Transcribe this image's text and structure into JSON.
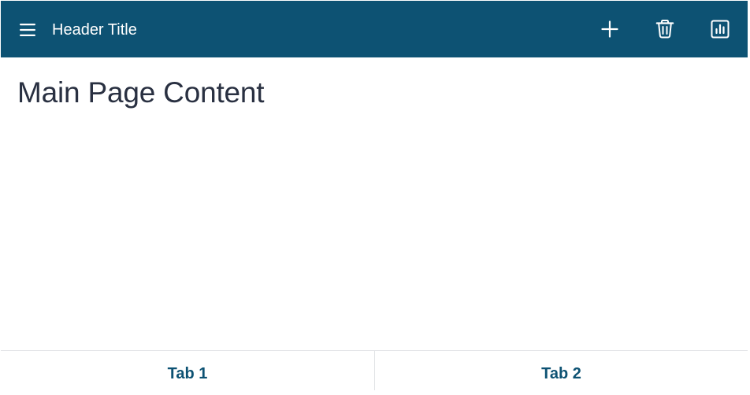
{
  "colors": {
    "header_bg": "#0d5273",
    "header_text": "#ffffff",
    "page_title": "#293041",
    "tab_text": "#0d5273",
    "divider": "#e3e5e8"
  },
  "header": {
    "menu_icon": "hamburger-menu-icon",
    "title": "Header Title",
    "actions": [
      {
        "icon": "plus-icon",
        "name": "add-button"
      },
      {
        "icon": "trash-icon",
        "name": "delete-button"
      },
      {
        "icon": "bar-chart-icon",
        "name": "chart-button"
      }
    ]
  },
  "main": {
    "title": "Main Page Content"
  },
  "tabs": [
    {
      "label": "Tab 1"
    },
    {
      "label": "Tab 2"
    }
  ]
}
